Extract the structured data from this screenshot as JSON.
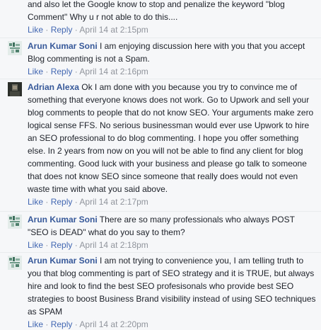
{
  "comments": [
    {
      "text": "and also let the Google know to stop and penalize the keyword \"blog Comment\" Why u r not able to do this....",
      "like": "Like",
      "reply": "Reply",
      "time": "April 14 at 2:15pm"
    },
    {
      "author": "Arun Kumar Soni",
      "avatar_icon": "profile-photo-icon",
      "text": "I am enjoying discussion here with you that you accept Blog commenting is not a Spam.",
      "like": "Like",
      "reply": "Reply",
      "time": "April 14 at 2:16pm"
    },
    {
      "author": "Adrian Alexa",
      "avatar_icon": "profile-photo-icon",
      "text": "Ok I am done with you because you try to convince me of something that everyone knows does not work. Go to Upwork and sell your blog comments to people that do not know SEO. Your arguments make zero logical sense FFS. No serious businessman would ever use Upwork to hire an SEO professional to do blog commenting. I hope you offer something else. In 2 years from now on you will not be able to find any client for blog commenting. Good luck with your business and please go talk to someone that does not know SEO since someone that really does would not even waste time with what you said above.",
      "like": "Like",
      "reply": "Reply",
      "time": "April 14 at 2:17pm"
    },
    {
      "author": "Arun Kumar Soni",
      "avatar_icon": "profile-photo-icon",
      "text": "There are so many professionals who always POST \"SEO is DEAD\" what do you say to them?",
      "like": "Like",
      "reply": "Reply",
      "time": "April 14 at 2:18pm"
    },
    {
      "author": "Arun Kumar Soni",
      "avatar_icon": "profile-photo-icon",
      "text": "I am not trying to convenience you, I am telling truth to you that blog commenting is part of SEO strategy and it is TRUE, but always hire and look to find the best SEO profesisonals who provide best SEO strategies to boost Business Brand visibility instead of using SEO techniques as SPAM",
      "like": "Like",
      "reply": "Reply",
      "time": "April 14 at 2:20pm"
    }
  ],
  "separators": {
    "dot": "·"
  }
}
